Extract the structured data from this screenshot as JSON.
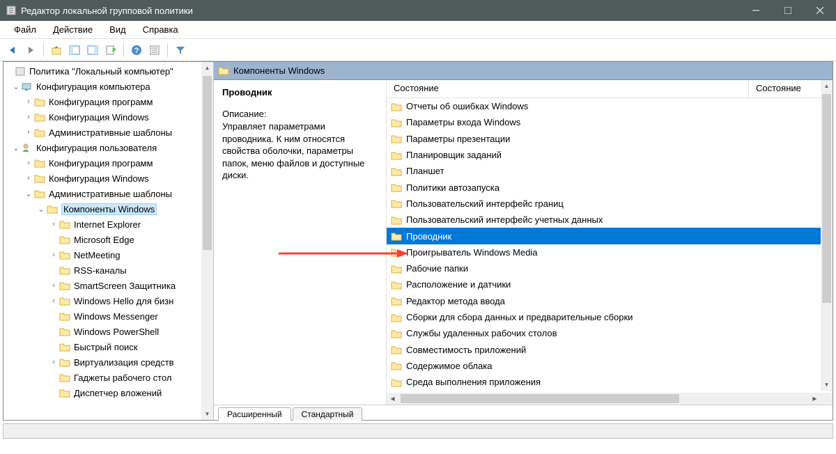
{
  "window": {
    "title": "Редактор локальной групповой политики"
  },
  "menu": {
    "file": "Файл",
    "action": "Действие",
    "view": "Вид",
    "help": "Справка"
  },
  "tree": {
    "root": "Политика \"Локальный компьютер\"",
    "comp_config": "Конфигурация компьютера",
    "comp_soft": "Конфигурация программ",
    "comp_win": "Конфигурация Windows",
    "comp_admin": "Административные шаблоны",
    "user_config": "Конфигурация пользователя",
    "user_soft": "Конфигурация программ",
    "user_win": "Конфигурация Windows",
    "user_admin": "Административные шаблоны",
    "win_components": "Компоненты Windows",
    "ie": "Internet Explorer",
    "edge": "Microsoft Edge",
    "netmeeting": "NetMeeting",
    "rss": "RSS-каналы",
    "smartscreen": "SmartScreen Защитника",
    "hello": "Windows Hello для бизн",
    "messenger": "Windows Messenger",
    "powershell": "Windows PowerShell",
    "quicksearch": "Быстрый поиск",
    "virtualization": "Виртуализация средств",
    "gadgets": "Гаджеты рабочего стол",
    "attachments": "Диспетчер вложений"
  },
  "header": {
    "title": "Компоненты Windows"
  },
  "details": {
    "title": "Проводник",
    "desc_label": "Описание:",
    "desc": "Управляет параметрами проводника. К ним относятся свойства оболочки, параметры папок, меню файлов и доступные диски."
  },
  "list_header": {
    "state1": "Состояние",
    "state2": "Состояние"
  },
  "list": {
    "items": [
      "Отчеты об ошибках Windows",
      "Параметры входа Windows",
      "Параметры презентации",
      "Планировщик заданий",
      "Планшет",
      "Политики автозапуска",
      "Пользовательский интерфейс границ",
      "Пользовательский интерфейс учетных данных",
      "Проводник",
      "Проигрыватель Windows Media",
      "Рабочие папки",
      "Расположение и датчики",
      "Редактор метода ввода",
      "Сборки для сбора данных и предварительные сборки",
      "Службы удаленных рабочих столов",
      "Совместимость приложений",
      "Содержимое облака",
      "Среда выполнения приложения"
    ],
    "selected_index": 8
  },
  "tabs": {
    "extended": "Расширенный",
    "standard": "Стандартный"
  }
}
